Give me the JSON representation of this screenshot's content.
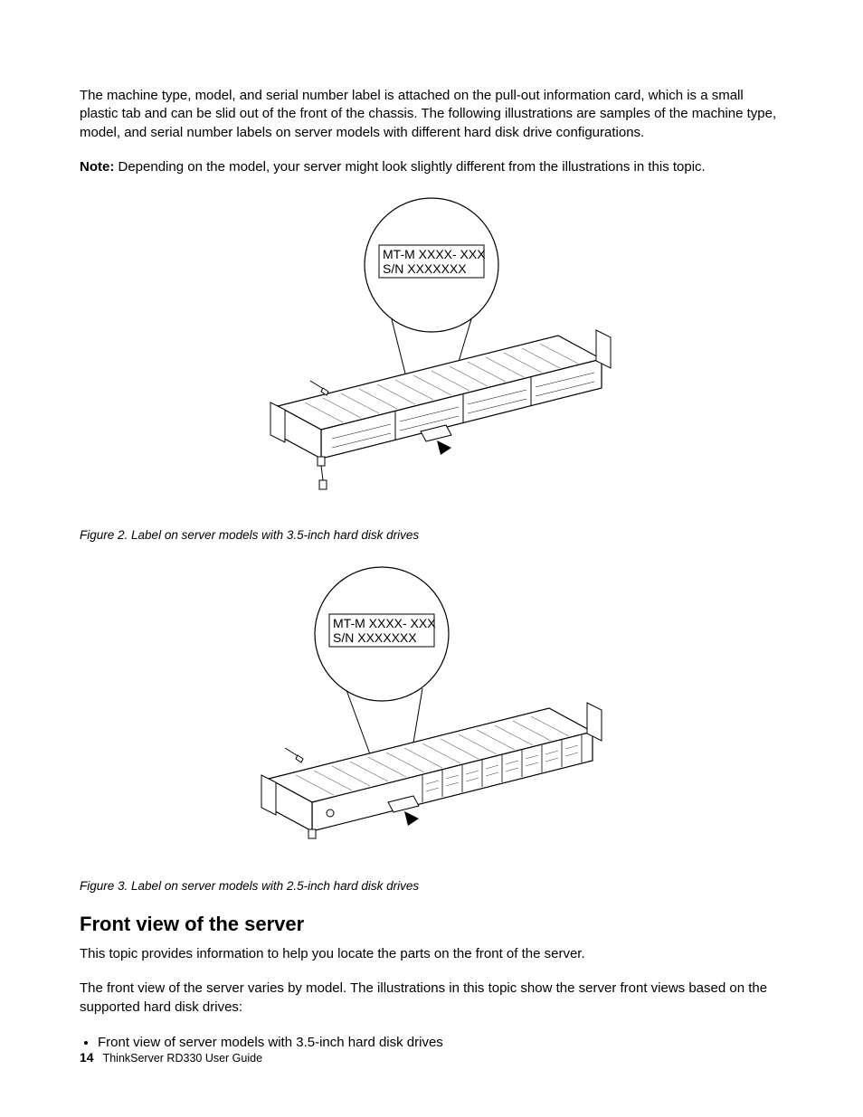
{
  "intro_para": "The machine type, model, and serial number label is attached on the pull-out information card, which is a small plastic tab and can be slid out of the front of the chassis. The following illustrations are samples of the machine type, model, and serial number labels on server models with different hard disk drive configurations.",
  "note_label": "Note:",
  "note_text": " Depending on the model, your server might look slightly different from the illustrations in this topic.",
  "callout_line1": "MT-M XXXX- XXX",
  "callout_line2": "S/N XXXXXXX",
  "fig2_caption_num": "Figure 2.",
  "fig2_caption_text": "  Label on server models with 3.5-inch hard disk drives",
  "fig3_caption_num": "Figure 3.",
  "fig3_caption_text": "  Label on server models with 2.5-inch hard disk drives",
  "section_heading": "Front view of the server",
  "section_p1": "This topic provides information to help you locate the parts on the front of the server.",
  "section_p2": "The front view of the server varies by model. The illustrations in this topic show the server front views based on the supported hard disk drives:",
  "bullet1": "Front view of server models with 3.5-inch hard disk drives",
  "footer_pagenum": "14",
  "footer_text": "ThinkServer RD330 User Guide"
}
